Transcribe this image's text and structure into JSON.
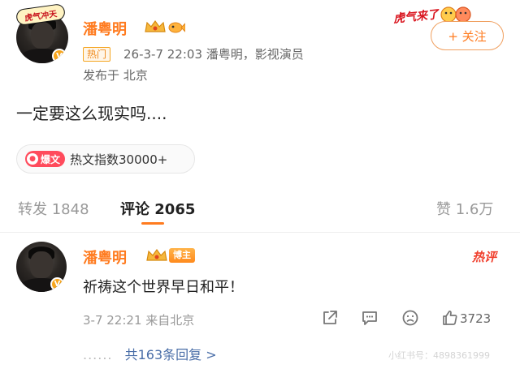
{
  "post": {
    "author": "潘粤明",
    "avatar_sticker": "虎气冲天",
    "hot_tag": "热门",
    "meta": "26-3-7 22:03  潘粤明，影视演员",
    "location": "发布于 北京",
    "deco_text": "虎气来了",
    "follow_label": "+ 关注",
    "text": "一定要这么现实吗....",
    "hot_badge": "爆文",
    "hot_index": "热文指数30000+"
  },
  "stats": {
    "repost": "转发 1848",
    "comment": "评论 2065",
    "like": "赞 1.6万"
  },
  "comment": {
    "author": "潘粤明",
    "host_badge": "博主",
    "hot_label": "热评",
    "text": "祈祷这个世界早日和平！",
    "time": "3-7 22:21 来自北京",
    "like_count": "3723",
    "replies_dots": "......",
    "replies_label": "共163条回复 >"
  },
  "icons": [
    "verified-v-icon",
    "crown-icon",
    "fish-icon",
    "share-icon",
    "reply-icon",
    "dislike-face-icon",
    "thumb-up-icon"
  ],
  "colors": {
    "accent_orange": "#ff7b1f",
    "link_blue": "#4a6ea8",
    "hot_red": "#ff4b5c"
  },
  "watermark": "小红书号：4898361999"
}
